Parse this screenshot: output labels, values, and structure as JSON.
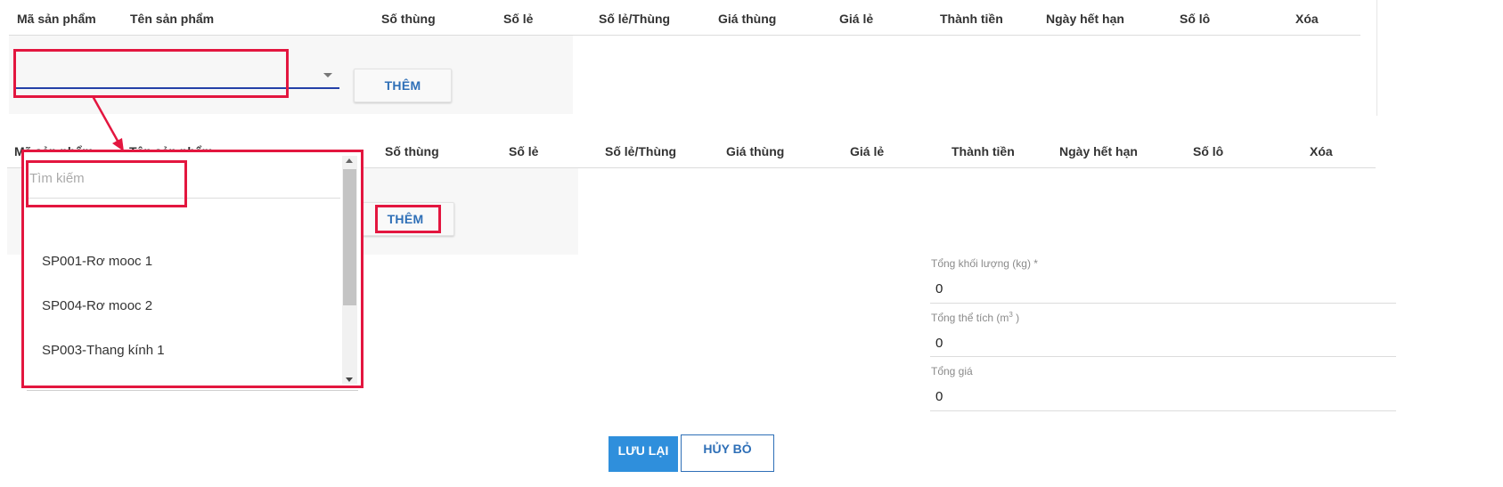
{
  "table_top": {
    "headers": [
      "Mã sản phẩm",
      "Tên sản phẩm",
      "Số thùng",
      "Số lẻ",
      "Số lẻ/Thùng",
      "Giá thùng",
      "Giá lẻ",
      "Thành tiền",
      "Ngày hết hạn",
      "Số lô",
      "Xóa"
    ],
    "add_label": "THÊM"
  },
  "table_bottom": {
    "headers": [
      "Mã sản phẩm",
      "Tên sản phẩm",
      "Số thùng",
      "Số lẻ",
      "Số lẻ/Thùng",
      "Giá thùng",
      "Giá lẻ",
      "Thành tiền",
      "Ngày hết hạn",
      "Số lô",
      "Xóa"
    ],
    "add_label": "THÊM"
  },
  "dropdown": {
    "search_placeholder": "Tìm kiếm",
    "options": [
      "SP001-Rơ mooc 1",
      "SP004-Rơ mooc 2",
      "SP003-Thang kính 1"
    ]
  },
  "totals": {
    "weight_label": "Tổng khối lượng (kg) *",
    "weight_value": "0",
    "volume_label_prefix": "Tổng thể tích (m",
    "volume_label_sup": "3",
    "volume_label_suffix": " )",
    "volume_value": "0",
    "price_label": "Tổng giá",
    "price_value": "0"
  },
  "actions": {
    "save_label": "LƯU LẠI",
    "cancel_label": "HỦY BỎ"
  },
  "colors": {
    "accent": "#2f8fdc",
    "annotation": "#e3163f",
    "link": "#2e6fb7"
  }
}
